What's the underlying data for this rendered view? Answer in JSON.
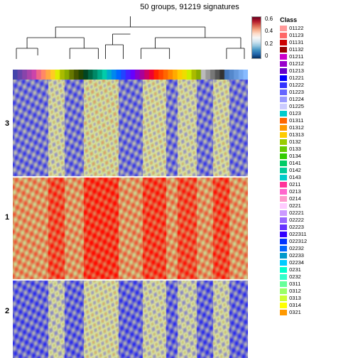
{
  "title": "50 groups, 91219 signatures",
  "colorScale": {
    "max": "0.6",
    "mid1": "0.4",
    "mid2": "0.2",
    "min": "0"
  },
  "classLabel": "Class",
  "rowLabels": [
    "3",
    "1",
    "2"
  ],
  "legendItems": [
    {
      "label": "01122",
      "color": "#FF9999"
    },
    {
      "label": "01123",
      "color": "#FF6666"
    },
    {
      "label": "01131",
      "color": "#CC0000"
    },
    {
      "label": "01132",
      "color": "#990000"
    },
    {
      "label": "01211",
      "color": "#CC00CC"
    },
    {
      "label": "01212",
      "color": "#9900CC"
    },
    {
      "label": "01213",
      "color": "#6600CC"
    },
    {
      "label": "01221",
      "color": "#0000FF"
    },
    {
      "label": "01222",
      "color": "#3333FF"
    },
    {
      "label": "01223",
      "color": "#6666FF"
    },
    {
      "label": "01224",
      "color": "#9999FF"
    },
    {
      "label": "01225",
      "color": "#CCCCFF"
    },
    {
      "label": "0123",
      "color": "#00CCCC"
    },
    {
      "label": "01311",
      "color": "#FF6600"
    },
    {
      "label": "01312",
      "color": "#FF9900"
    },
    {
      "label": "01313",
      "color": "#FFCC00"
    },
    {
      "label": "0132",
      "color": "#99CC00"
    },
    {
      "label": "0133",
      "color": "#66CC00"
    },
    {
      "label": "0134",
      "color": "#33CC00"
    },
    {
      "label": "0141",
      "color": "#00CC66"
    },
    {
      "label": "0142",
      "color": "#00CC99"
    },
    {
      "label": "0143",
      "color": "#00CCCC"
    },
    {
      "label": "0211",
      "color": "#FF3399"
    },
    {
      "label": "0213",
      "color": "#FF66CC"
    },
    {
      "label": "0214",
      "color": "#FF99CC"
    },
    {
      "label": "0221",
      "color": "#FFCCFF"
    },
    {
      "label": "02221",
      "color": "#CC99FF"
    },
    {
      "label": "02222",
      "color": "#9966FF"
    },
    {
      "label": "02223",
      "color": "#6633FF"
    },
    {
      "label": "022311",
      "color": "#3300FF"
    },
    {
      "label": "022312",
      "color": "#0033FF"
    },
    {
      "label": "02232",
      "color": "#0066FF"
    },
    {
      "label": "02233",
      "color": "#0099CC"
    },
    {
      "label": "02234",
      "color": "#00CCFF"
    },
    {
      "label": "0231",
      "color": "#00FFCC"
    },
    {
      "label": "0232",
      "color": "#33FFCC"
    },
    {
      "label": "0311",
      "color": "#66FF99"
    },
    {
      "label": "0312",
      "color": "#99FF66"
    },
    {
      "label": "0313",
      "color": "#CCFF33"
    },
    {
      "label": "0314",
      "color": "#FFFF00"
    },
    {
      "label": "0321",
      "color": "#FF9900"
    }
  ]
}
